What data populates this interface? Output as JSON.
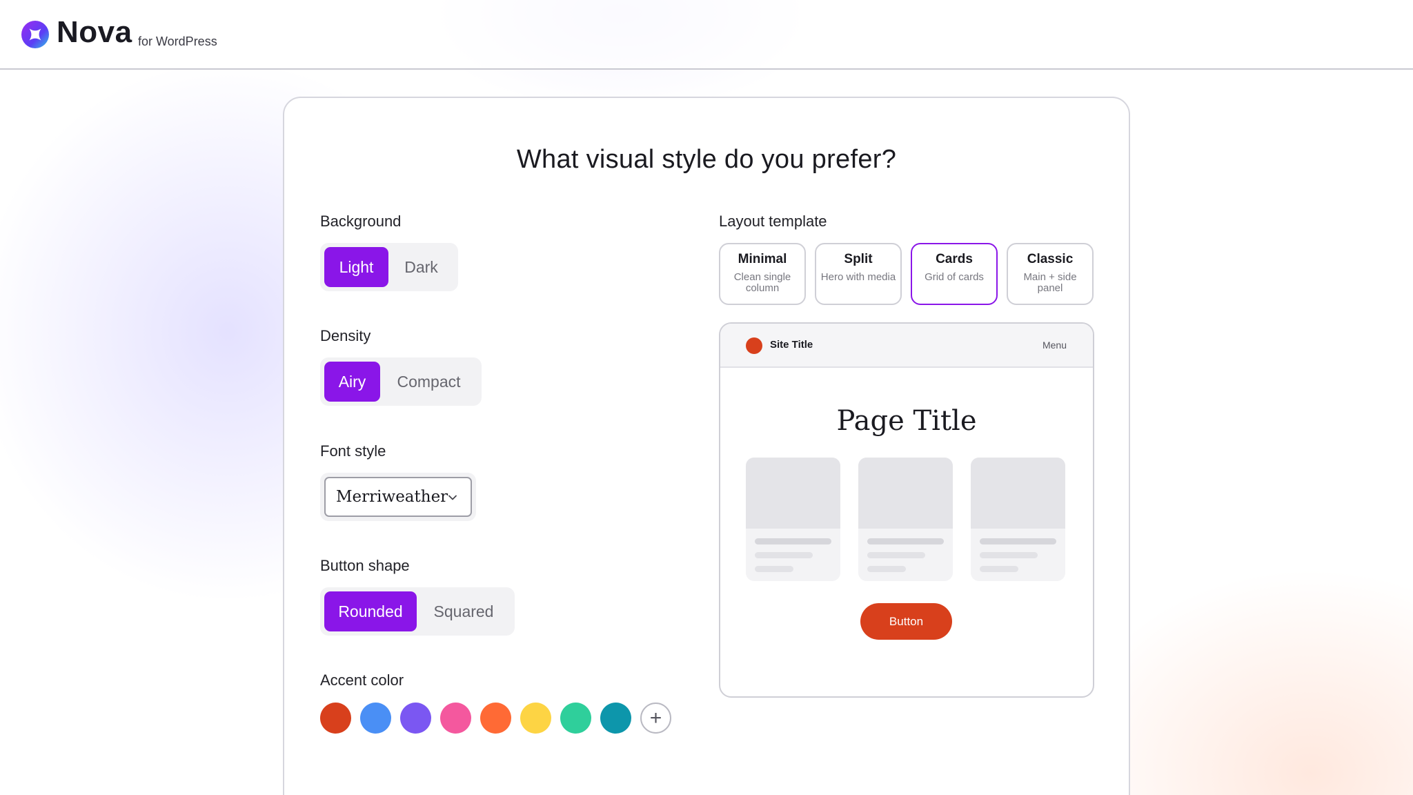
{
  "header": {
    "brand": "Nova",
    "brand_sub": "for WordPress"
  },
  "question": "What visual style do you prefer?",
  "background": {
    "label": "Background",
    "options": [
      "Light",
      "Dark"
    ],
    "selected": "Light"
  },
  "density": {
    "label": "Density",
    "options": [
      "Airy",
      "Compact"
    ],
    "selected": "Airy"
  },
  "font_style": {
    "label": "Font style",
    "value": "Merriweather"
  },
  "button_shape": {
    "label": "Button shape",
    "options": [
      "Rounded",
      "Squared"
    ],
    "selected": "Rounded"
  },
  "accent_color": {
    "label": "Accent color",
    "colors": [
      "#d8401c",
      "#4a8ff5",
      "#7b57f2",
      "#f4589e",
      "#ff6a35",
      "#fdd444",
      "#2fcf9b",
      "#0d96ab"
    ],
    "add_symbol": "+"
  },
  "layout_template": {
    "label": "Layout template",
    "options": [
      {
        "name": "Minimal",
        "desc": "Clean single column"
      },
      {
        "name": "Split",
        "desc": "Hero with media"
      },
      {
        "name": "Cards",
        "desc": "Grid of cards"
      },
      {
        "name": "Classic",
        "desc": "Main + side panel"
      }
    ],
    "selected": "Cards"
  },
  "preview": {
    "site_title": "Site Title",
    "menu": "Menu",
    "page_title": "Page Title",
    "button": "Button",
    "accent": "#d8401c"
  },
  "colors": {
    "primary": "#8a16e8"
  }
}
